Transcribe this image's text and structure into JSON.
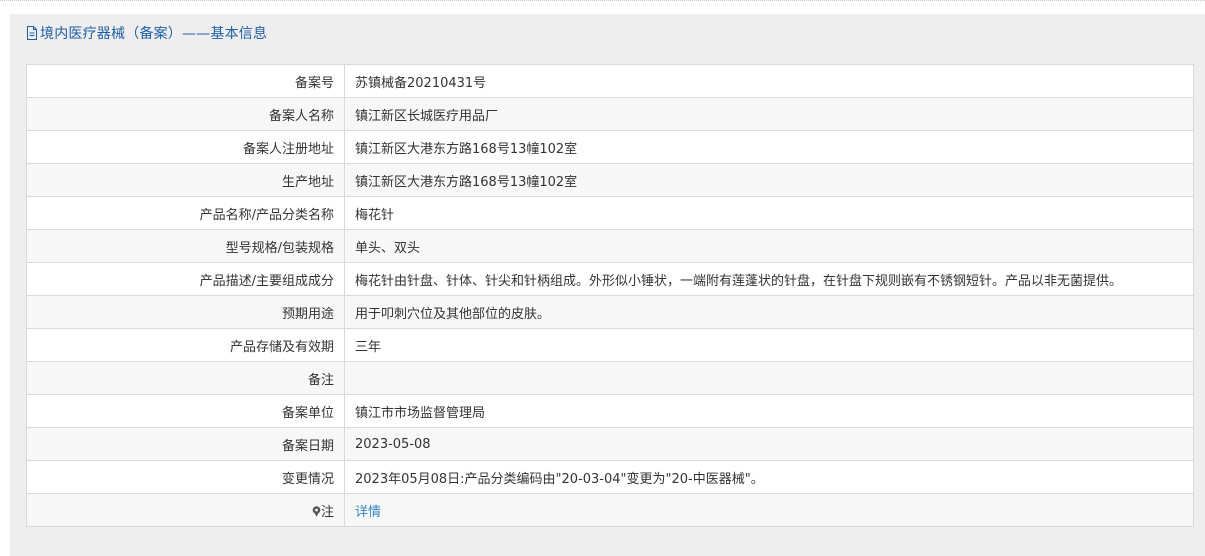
{
  "header": {
    "icon": "document-icon",
    "title": "境内医疗器械（备案）——基本信息"
  },
  "rows": [
    {
      "label": "备案号",
      "value": "苏镇械备20210431号"
    },
    {
      "label": "备案人名称",
      "value": "镇江新区长城医疗用品厂"
    },
    {
      "label": "备案人注册地址",
      "value": "镇江新区大港东方路168号13幢102室"
    },
    {
      "label": "生产地址",
      "value": "镇江新区大港东方路168号13幢102室"
    },
    {
      "label": "产品名称/产品分类名称",
      "value": "梅花针"
    },
    {
      "label": "型号规格/包装规格",
      "value": "单头、双头"
    },
    {
      "label": "产品描述/主要组成成分",
      "value": "梅花针由针盘、针体、针尖和针柄组成。外形似小锤状，一端附有莲蓬状的针盘，在针盘下规则嵌有不锈钢短针。产品以非无菌提供。"
    },
    {
      "label": "预期用途",
      "value": "用于叩刺穴位及其他部位的皮肤。"
    },
    {
      "label": "产品存储及有效期",
      "value": "三年"
    },
    {
      "label": "备注",
      "value": ""
    },
    {
      "label": "备案单位",
      "value": "镇江市市场监督管理局"
    },
    {
      "label": "备案日期",
      "value": "2023-05-08"
    },
    {
      "label": "变更情况",
      "value": "2023年05月08日:产品分类编码由\"20-03-04\"变更为\"20-中医器械\"。"
    }
  ],
  "note": {
    "icon": "pin-icon",
    "label": "注",
    "link_text": "详情"
  },
  "colors": {
    "title": "#1f5fa6",
    "link": "#2f86c8",
    "header_bg": "#eeeeee",
    "row_alt": "#f7f7f7",
    "border": "#d9d9d9"
  }
}
